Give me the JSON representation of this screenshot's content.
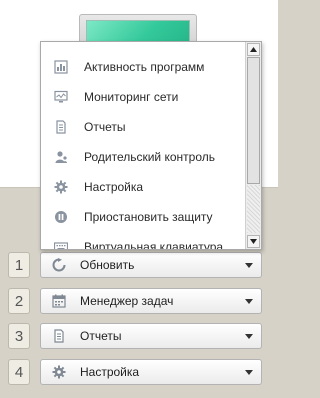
{
  "menu": {
    "items": [
      {
        "label": "Активность программ",
        "icon": "activity-chart-icon"
      },
      {
        "label": "Мониторинг сети",
        "icon": "network-monitor-icon"
      },
      {
        "label": "Отчеты",
        "icon": "reports-document-icon"
      },
      {
        "label": "Родительский контроль",
        "icon": "parental-control-icon"
      },
      {
        "label": "Настройка",
        "icon": "gear-icon"
      },
      {
        "label": "Приостановить защиту",
        "icon": "pause-icon"
      },
      {
        "label": "Виртуальная клавиатура",
        "icon": "keyboard-icon"
      }
    ]
  },
  "quick_buttons": [
    {
      "number": "1",
      "label": "Обновить",
      "icon": "refresh-icon"
    },
    {
      "number": "2",
      "label": "Менеджер задач",
      "icon": "task-manager-icon"
    },
    {
      "number": "3",
      "label": "Отчеты",
      "icon": "reports-document-icon"
    },
    {
      "number": "4",
      "label": "Настройка",
      "icon": "gear-icon"
    }
  ],
  "colors": {
    "background": "#d6d2c8",
    "accent_green": "#34c99a",
    "icon_gray": "#8a93a0"
  }
}
